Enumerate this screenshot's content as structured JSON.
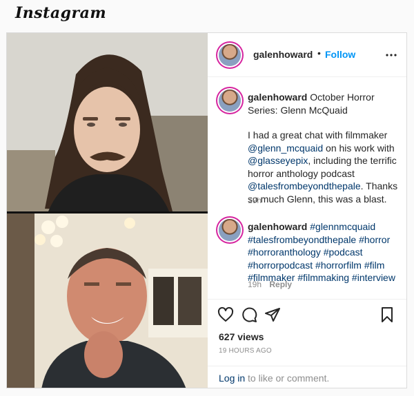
{
  "app": {
    "logo_text": "Instagram"
  },
  "post": {
    "username": "galenhoward",
    "follow_sep": "•",
    "follow_label": "Follow",
    "more_icon": "more-horizontal-icon",
    "caption": {
      "username": "galenhoward",
      "title": " October Horror Series: Glenn McQuaid",
      "p1_a": "I had a great chat with filmmaker ",
      "mention1": "@glenn_mcquaid",
      "p1_b": " on his work with ",
      "mention2": "@glasseyepix",
      "p1_c": ", including the terrific horror anthology podcast ",
      "mention3": "@talesfrombeyondthepale",
      "p1_d": ". Thanks so much Glenn, this was a blast.",
      "time": "19h"
    },
    "comment": {
      "username": "galenhoward",
      "hashtags": "#glennmcquaid #talesfrombeyondthepale #horror #horroranthology #podcast #horrorpodcast #horrorfilm #film #filmmaker #filmmaking #interview",
      "time": "19h",
      "reply_label": "Reply"
    },
    "actions": {
      "like_icon": "heart-icon",
      "comment_icon": "comment-icon",
      "share_icon": "send-icon",
      "save_icon": "bookmark-icon"
    },
    "views": "627 views",
    "posted": "19 HOURS AGO",
    "login_link": "Log in",
    "login_rest": " to like or comment."
  },
  "colors": {
    "link": "#00376b",
    "follow": "#0095f6",
    "muted": "#8e8e8e",
    "border": "#dbdbdb"
  }
}
